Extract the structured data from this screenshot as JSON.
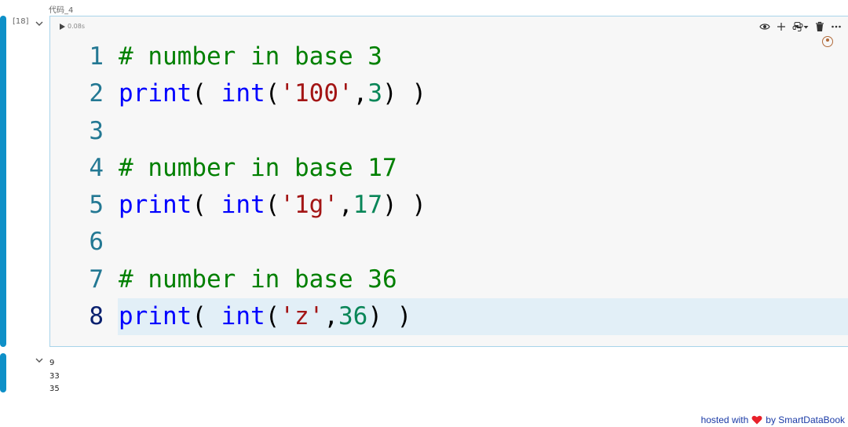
{
  "cell": {
    "title": "代码_4",
    "execution_count": "[18]",
    "exec_time": "0.08s",
    "code_lines": [
      {
        "number": "1",
        "tokens": [
          {
            "t": "# number in base 3",
            "c": "comment"
          }
        ]
      },
      {
        "number": "2",
        "tokens": [
          {
            "t": "print",
            "c": "kw"
          },
          {
            "t": "( ",
            "c": "plain"
          },
          {
            "t": "int",
            "c": "kw"
          },
          {
            "t": "(",
            "c": "plain"
          },
          {
            "t": "'100'",
            "c": "str"
          },
          {
            "t": ",",
            "c": "plain"
          },
          {
            "t": "3",
            "c": "num"
          },
          {
            "t": ") )",
            "c": "plain"
          }
        ]
      },
      {
        "number": "3",
        "tokens": []
      },
      {
        "number": "4",
        "tokens": [
          {
            "t": "# number in base 17",
            "c": "comment"
          }
        ]
      },
      {
        "number": "5",
        "tokens": [
          {
            "t": "print",
            "c": "kw"
          },
          {
            "t": "( ",
            "c": "plain"
          },
          {
            "t": "int",
            "c": "kw"
          },
          {
            "t": "(",
            "c": "plain"
          },
          {
            "t": "'1g'",
            "c": "str"
          },
          {
            "t": ",",
            "c": "plain"
          },
          {
            "t": "17",
            "c": "num"
          },
          {
            "t": ") )",
            "c": "plain"
          }
        ]
      },
      {
        "number": "6",
        "tokens": []
      },
      {
        "number": "7",
        "tokens": [
          {
            "t": "# number in base 36",
            "c": "comment"
          }
        ]
      },
      {
        "number": "8",
        "tokens": [
          {
            "t": "print",
            "c": "kw"
          },
          {
            "t": "( ",
            "c": "plain"
          },
          {
            "t": "int",
            "c": "kw"
          },
          {
            "t": "(",
            "c": "plain"
          },
          {
            "t": "'z'",
            "c": "str"
          },
          {
            "t": ",",
            "c": "plain"
          },
          {
            "t": "36",
            "c": "num"
          },
          {
            "t": ") )",
            "c": "plain"
          }
        ]
      }
    ],
    "active_line": 8,
    "toolbar_icons": [
      "eye-icon",
      "plus-icon",
      "python-icon",
      "chevron-down-icon",
      "trash-icon",
      "more-icon"
    ]
  },
  "outputs": [
    "9",
    "33",
    "35"
  ],
  "footer": {
    "prefix": "hosted with",
    "suffix": "by SmartDataBook"
  },
  "colors": {
    "accent_bar": "#0e90c8",
    "comment": "#008000",
    "keyword": "#0000ff",
    "string": "#a31515",
    "number": "#098658",
    "line_number": "#237893",
    "active_line_bg": "#e2eff7"
  }
}
